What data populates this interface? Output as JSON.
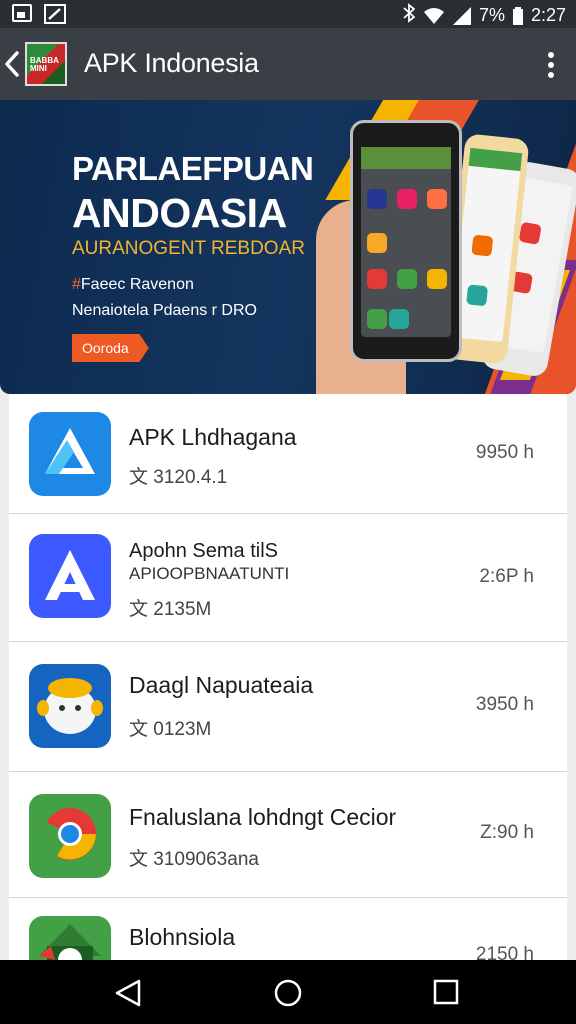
{
  "status_bar": {
    "percent": "7%",
    "time": "2:27",
    "icons": [
      "image-icon",
      "edit-icon",
      "bluetooth-icon",
      "wifi-icon",
      "signal-icon",
      "battery-icon"
    ]
  },
  "app_bar": {
    "title": "APK Indonesia",
    "logo_text": "BABBA MINI",
    "icons": [
      "back-icon",
      "app-logo",
      "overflow-menu-icon"
    ]
  },
  "banner": {
    "heading_1": "PARLAEFPUAN",
    "heading_2": "ANDOASIA",
    "heading_3": "AURANOGENT REBDOAR",
    "line_1_prefix": "#",
    "line_1": "Faeec Ravenon",
    "line_2": "Nenaiotela Pdaens r DRO",
    "button_label": "Ooroda",
    "colors": {
      "background": "#0d2a4f",
      "accent": "#ee5a24",
      "subheading": "#f2b531"
    }
  },
  "apps": [
    {
      "title": "APK Lhdhagana",
      "subtitle": "",
      "meta": "文 3120.4.1",
      "time": "9950 h",
      "icon": "drive-style-icon"
    },
    {
      "title": "Apohn Sema tilS",
      "subtitle": "APIOOPBNAATUNTI",
      "meta": "文 2135M",
      "time": "2:6P h",
      "icon": "letter-a-icon"
    },
    {
      "title": "Daagl Napuateaia",
      "subtitle": "",
      "meta": "文 0123M",
      "time": "3950 h",
      "icon": "mascot-icon"
    },
    {
      "title": "Fnaluslana lohdngt Cecior",
      "subtitle": "",
      "meta": "文 3109063ana",
      "time": "Z:90 h",
      "icon": "chrome-style-icon"
    },
    {
      "title": "Blohnsiola",
      "subtitle": "",
      "meta": "",
      "time": "2150 h",
      "icon": "green-mascot-icon"
    }
  ],
  "nav_bar": {
    "icons": [
      "nav-back-icon",
      "nav-home-icon",
      "nav-recents-icon"
    ]
  }
}
